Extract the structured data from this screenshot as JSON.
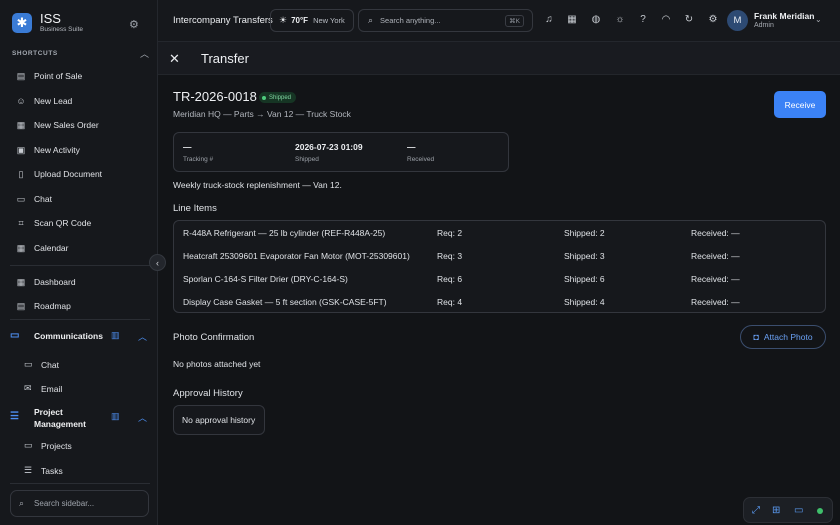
{
  "brand": {
    "name": "ISS",
    "subtitle": "Business Suite"
  },
  "sidebar": {
    "shortcuts_header": "SHORTCUTS",
    "shortcuts": [
      {
        "label": "Point of Sale",
        "icon": "store-icon"
      },
      {
        "label": "New Lead",
        "icon": "user-plus-icon"
      },
      {
        "label": "New Sales Order",
        "icon": "receipt-icon"
      },
      {
        "label": "New Activity",
        "icon": "calendar-plus-icon"
      },
      {
        "label": "Upload Document",
        "icon": "file-upload-icon"
      },
      {
        "label": "Chat",
        "icon": "chat-icon"
      },
      {
        "label": "Scan QR Code",
        "icon": "qr-code-icon"
      },
      {
        "label": "Calendar",
        "icon": "calendar-icon"
      }
    ],
    "nav": [
      {
        "label": "Dashboard",
        "icon": "dashboard-icon"
      },
      {
        "label": "Roadmap",
        "icon": "map-icon"
      }
    ],
    "groups": [
      {
        "label": "Communications",
        "icon": "communications-icon",
        "items": [
          {
            "label": "Chat",
            "icon": "chat-icon"
          },
          {
            "label": "Email",
            "icon": "mail-icon"
          }
        ]
      },
      {
        "label": "Project\nManagement",
        "label_line1": "Project",
        "label_line2": "Management",
        "icon": "tasks-icon",
        "items": [
          {
            "label": "Projects",
            "icon": "folder-icon"
          },
          {
            "label": "Tasks",
            "icon": "checklist-icon"
          }
        ]
      }
    ],
    "search_placeholder": "Search sidebar..."
  },
  "topbar": {
    "tab_title": "Intercompany Transfers",
    "weather": {
      "temp": "70°F",
      "city": "New York"
    },
    "search_placeholder": "Search anything...",
    "search_shortcut": "⌘K",
    "user": {
      "initial": "M",
      "name": "Frank Meridian",
      "role": "Admin"
    }
  },
  "page": {
    "title": "Transfer",
    "transfer_id": "TR-2026-0018",
    "status": "Shipped",
    "route": "Meridian HQ — Parts → Van 12 — Truck Stock",
    "receive_label": "Receive",
    "info": [
      {
        "value": "—",
        "label": "Tracking #"
      },
      {
        "value": "2026-07-23 01:09",
        "label": "Shipped"
      },
      {
        "value": "—",
        "label": "Received"
      }
    ],
    "description": "Weekly truck-stock replenishment — Van 12.",
    "line_items_title": "Line Items",
    "line_items": [
      {
        "name": "R-448A Refrigerant — 25 lb cylinder (REF-R448A-25)",
        "req": "Req: 2",
        "shipped": "Shipped: 2",
        "received": "Received: —"
      },
      {
        "name": "Heatcraft 25309601 Evaporator Fan Motor (MOT-25309601)",
        "req": "Req: 3",
        "shipped": "Shipped: 3",
        "received": "Received: —"
      },
      {
        "name": "Sporlan C-164-S Filter Drier (DRY-C-164-S)",
        "req": "Req: 6",
        "shipped": "Shipped: 6",
        "received": "Received: —"
      },
      {
        "name": "Display Case Gasket — 5 ft section (GSK-CASE-5FT)",
        "req": "Req: 4",
        "shipped": "Shipped: 4",
        "received": "Received: —"
      }
    ],
    "photo_title": "Photo Confirmation",
    "attach_label": "Attach Photo",
    "no_photos": "No photos attached yet",
    "approval_title": "Approval History",
    "no_approval": "No approval history"
  },
  "colors": {
    "accent": "#3b82f6",
    "status_green": "#4ecb7d",
    "background": "#121417"
  }
}
